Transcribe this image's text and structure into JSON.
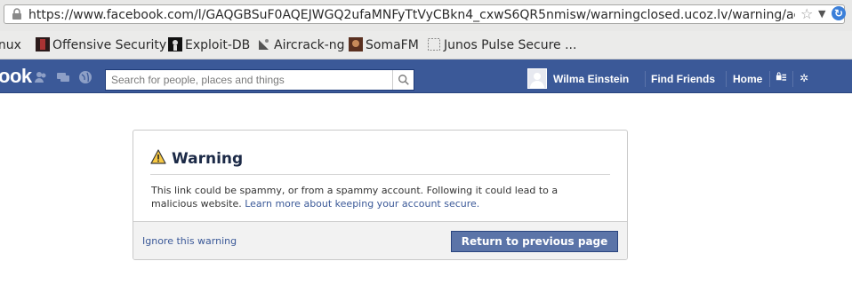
{
  "browser": {
    "url": "https://www.facebook.com/l/GAQGBSuF0AQEJWGQ2ufaMNFyTtVyCBkn4_cxwS6QR5nmisw/warningclosed.ucoz.lv/warning/account/di",
    "bookmarks": [
      {
        "label": "inux"
      },
      {
        "label": "Offensive Security"
      },
      {
        "label": "Exploit-DB"
      },
      {
        "label": "Aircrack-ng"
      },
      {
        "label": "SomaFM"
      },
      {
        "label": "Junos Pulse Secure ..."
      }
    ]
  },
  "fb_bar": {
    "logo": "ook",
    "search_placeholder": "Search for people, places and things",
    "user_name": "Wilma Einstein",
    "find_friends": "Find Friends",
    "home": "Home",
    "colors": {
      "bar": "#3b5998"
    }
  },
  "dialog": {
    "title": "Warning",
    "body": "This link could be spammy, or from a spammy account. Following it could lead to a malicious website.",
    "learn_more": "Learn more about keeping your account secure.",
    "ignore": "Ignore this warning",
    "return": "Return to previous page"
  }
}
